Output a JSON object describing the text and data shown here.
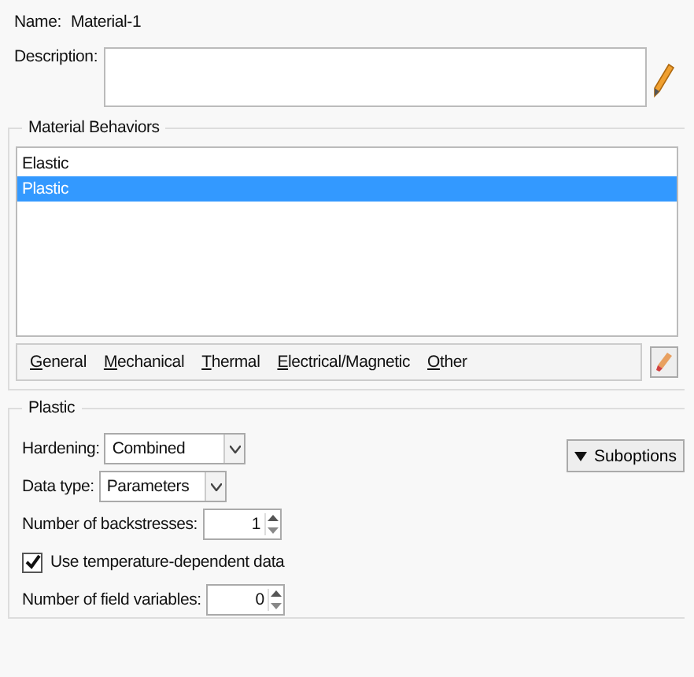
{
  "name_label": "Name:",
  "name_value": "Material-1",
  "description": {
    "label": "Description:"
  },
  "behaviors": {
    "title": "Material Behaviors",
    "items": [
      {
        "label": "Elastic",
        "selected": false
      },
      {
        "label": "Plastic",
        "selected": true
      }
    ]
  },
  "menu": [
    "General",
    "Mechanical",
    "Thermal",
    "Electrical/Magnetic",
    "Other"
  ],
  "plastic": {
    "title": "Plastic",
    "suboptions": "Suboptions",
    "controls": [
      {
        "kind": "combo",
        "label": "Hardening:",
        "value": "Combined"
      },
      {
        "kind": "combo",
        "label": "Data type:",
        "value": "Parameters"
      },
      {
        "kind": "spin",
        "label": "Number of backstresses:",
        "value": "1"
      },
      {
        "kind": "check",
        "label": "Use temperature-dependent data",
        "checked": true
      },
      {
        "kind": "spin",
        "label": "Number of field variables:",
        "value": "0"
      }
    ]
  }
}
